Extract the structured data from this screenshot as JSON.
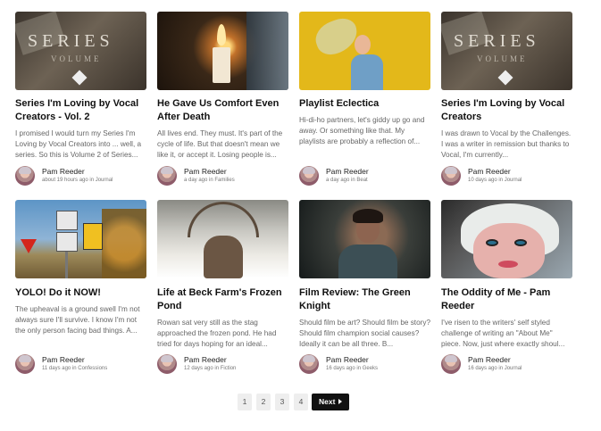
{
  "posts": [
    {
      "title": "Series I'm Loving by Vocal Creators - Vol. 2",
      "excerpt": "I promised I would turn my Series I'm Loving by Vocal Creators into ... well, a series. So this is Volume 2 of Series...",
      "author": "Pam Reeder",
      "meta": "about 19 hours ago in Journal",
      "thumb": "series-volume-image"
    },
    {
      "title": "He Gave Us Comfort Even After Death",
      "excerpt": "All lives end. They must. It's part of the cycle of life. But that doesn't mean we like it, or accept it. Losing people is...",
      "author": "Pam Reeder",
      "meta": "a day ago in Families",
      "thumb": "candle-image"
    },
    {
      "title": "Playlist Eclectica",
      "excerpt": "Hi-di-ho partners, let's giddy up go and away. Or something like that. My playlists are probably a reflection of...",
      "author": "Pam Reeder",
      "meta": "a day ago in Beat",
      "thumb": "woman-yellow-background-image"
    },
    {
      "title": "Series I'm Loving by Vocal Creators",
      "excerpt": "I was drawn to Vocal by the Challenges. I was a writer in remission but thanks to Vocal, I'm currently...",
      "author": "Pam Reeder",
      "meta": "10 days ago in Journal",
      "thumb": "series-volume-image"
    },
    {
      "title": "YOLO! Do it NOW!",
      "excerpt": "The upheaval is a ground swell I'm not always sure I'll survive. I know I'm not the only person facing bad things. A...",
      "author": "Pam Reeder",
      "meta": "11 days ago in Confessions",
      "thumb": "road-signs-image"
    },
    {
      "title": "Life at Beck Farm's Frozen Pond",
      "excerpt": "Rowan sat very still as the stag approached the frozen pond. He had tried for days hoping for an ideal...",
      "author": "Pam Reeder",
      "meta": "12 days ago in Fiction",
      "thumb": "stag-snow-image"
    },
    {
      "title": "Film Review: The Green Knight",
      "excerpt": "Should film be art? Should film be story? Should film champion social causes? Ideally it can be all three. B...",
      "author": "Pam Reeder",
      "meta": "16 days ago in Geeks",
      "thumb": "film-still-image"
    },
    {
      "title": "The Oddity of Me - Pam Reeder",
      "excerpt": "I've risen to the writers' self styled challenge of writing an \"About Me\" piece. Now, just where exactly shoul...",
      "author": "Pam Reeder",
      "meta": "16 days ago in Journal",
      "thumb": "face-portrait-image"
    }
  ],
  "pagination": {
    "pages": [
      "1",
      "2",
      "3",
      "4"
    ],
    "next_label": "Next"
  },
  "thumb_texts": {
    "series_word": "SERIES",
    "volume_word": "VOLUME"
  }
}
